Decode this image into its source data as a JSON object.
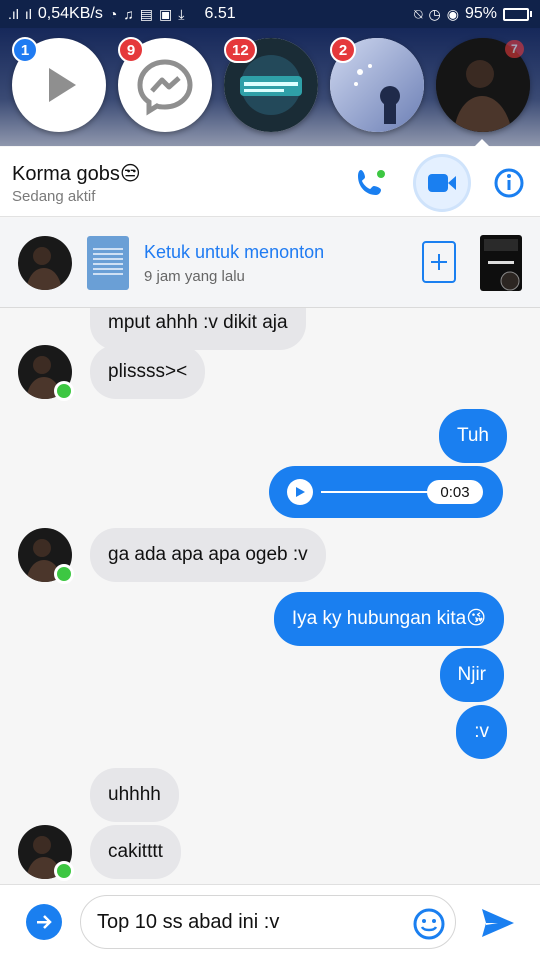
{
  "status_bar": {
    "network_speed": "0,54KB/s",
    "time": "6.51",
    "battery": "95%",
    "battery_level": 0.95
  },
  "chat_heads": [
    {
      "badge": "1",
      "icon": "play-icon"
    },
    {
      "badge": "9",
      "icon": "messenger-icon"
    },
    {
      "badge": "12",
      "icon": "avatar-anime-group"
    },
    {
      "badge": "2",
      "icon": "avatar-art"
    },
    {
      "badge": "7",
      "icon": "avatar-contact"
    }
  ],
  "header": {
    "contact_name": "Korma gobs😒",
    "contact_status": "Sedang aktif",
    "icons": [
      "phone-icon",
      "video-camera-icon",
      "info-icon"
    ]
  },
  "story": {
    "title": "Ketuk untuk menonton",
    "subtitle": "9 jam yang lalu",
    "icons": [
      "add-icon"
    ]
  },
  "messages": [
    {
      "side": "in",
      "text": "mput ahhh :v dikit aja"
    },
    {
      "side": "in",
      "text": "plissss><"
    },
    {
      "side": "out",
      "text": "Tuh"
    },
    {
      "side": "out",
      "type": "voice",
      "duration": "0:03"
    },
    {
      "side": "in",
      "text": "ga ada apa apa ogeb :v"
    },
    {
      "side": "out",
      "text": "Iya ky hubungan kita😘"
    },
    {
      "side": "out",
      "text": "Njir"
    },
    {
      "side": "out",
      "text": ":v"
    },
    {
      "side": "in",
      "text": "uhhhh"
    },
    {
      "side": "in",
      "text": "cakitttt"
    }
  ],
  "composer": {
    "text": "Top 10 ss abad ini :v",
    "icons": [
      "expand-arrow-icon",
      "emoji-icon",
      "send-icon"
    ]
  },
  "colors": {
    "accent": "#1a7ff0",
    "online": "#3dc742",
    "badge_red": "#e5383b"
  }
}
